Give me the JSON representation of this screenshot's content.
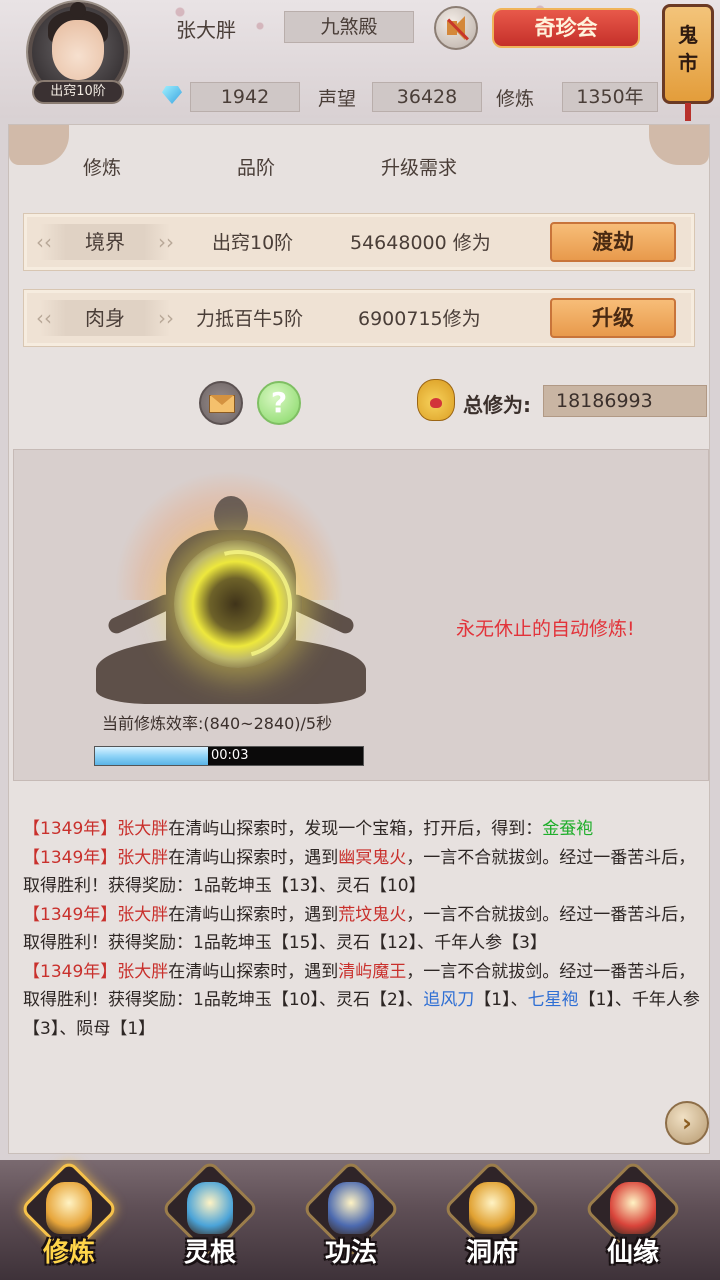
{
  "header": {
    "player_name": "张大胖",
    "sect": "九煞殿",
    "rank_badge": "出窍10阶",
    "treasure_button": "奇珍会",
    "market_button": "鬼市",
    "spirit_stones": "1942",
    "reputation_label": "声望",
    "reputation": "36428",
    "cultivation_label": "修炼",
    "cultivation_years": "1350年"
  },
  "columns": {
    "col1": "修炼",
    "col2": "品阶",
    "col3": "升级需求"
  },
  "rows": [
    {
      "tag": "境界",
      "grade": "出窍10阶",
      "requirement": "54648000 修为",
      "button": "渡劫"
    },
    {
      "tag": "肉身",
      "grade": "力抵百牛5阶",
      "requirement": "6900715修为",
      "button": "升级"
    }
  ],
  "total": {
    "label": "总修为:",
    "value": "18186993"
  },
  "cultivate": {
    "auto_text": "永无休止的自动修炼!",
    "rate_text": "当前修炼效率:(840~2840)/5秒",
    "progress_fraction": 0.42,
    "progress_time": "00:03"
  },
  "log": [
    {
      "year": "【1349年】",
      "segments": [
        {
          "t": "张大胖",
          "c": "nm"
        },
        {
          "t": "在清屿山探索时，发现一个宝箱，打开后，得到："
        },
        {
          "t": "金蚕袍",
          "c": "green"
        }
      ]
    },
    {
      "year": "【1349年】",
      "segments": [
        {
          "t": "张大胖",
          "c": "nm"
        },
        {
          "t": "在清屿山探索时，遇到"
        },
        {
          "t": "幽冥鬼火",
          "c": "nm"
        },
        {
          "t": "，一言不合就拔剑。经过一番苦斗后，取得胜利！获得奖励：1品乾坤玉【13】、灵石【10】"
        }
      ]
    },
    {
      "year": "【1349年】",
      "segments": [
        {
          "t": "张大胖",
          "c": "nm"
        },
        {
          "t": "在清屿山探索时，遇到"
        },
        {
          "t": "荒坟鬼火",
          "c": "nm"
        },
        {
          "t": "，一言不合就拔剑。经过一番苦斗后，取得胜利！获得奖励：1品乾坤玉【15】、灵石【12】、千年人参【3】"
        }
      ]
    },
    {
      "year": "【1349年】",
      "segments": [
        {
          "t": "张大胖",
          "c": "nm"
        },
        {
          "t": "在清屿山探索时，遇到"
        },
        {
          "t": "清屿魔王",
          "c": "nm"
        },
        {
          "t": "，一言不合就拔剑。经过一番苦斗后，取得胜利！获得奖励：1品乾坤玉【10】、灵石【2】、"
        },
        {
          "t": "追风刀",
          "c": "blue"
        },
        {
          "t": "【1】、"
        },
        {
          "t": "七星袍",
          "c": "blue"
        },
        {
          "t": "【1】、千年人参【3】、陨母【1】"
        }
      ]
    }
  ],
  "nav": [
    {
      "label": "修炼",
      "icon": "meditating-monk-icon",
      "color": "#e7a53a",
      "active": true
    },
    {
      "label": "灵根",
      "icon": "sword-root-icon",
      "color": "#4aa3d8",
      "active": false
    },
    {
      "label": "功法",
      "icon": "scroll-book-icon",
      "color": "#4c6ab0",
      "active": false
    },
    {
      "label": "洞府",
      "icon": "pavilion-icon",
      "color": "#e0a030",
      "active": false
    },
    {
      "label": "仙缘",
      "icon": "gourd-icon",
      "color": "#d9443a",
      "active": false
    }
  ],
  "colors": {
    "accent_red": "#c9302c",
    "reward_green": "#1fae2b",
    "reward_blue": "#2f6fd4"
  }
}
